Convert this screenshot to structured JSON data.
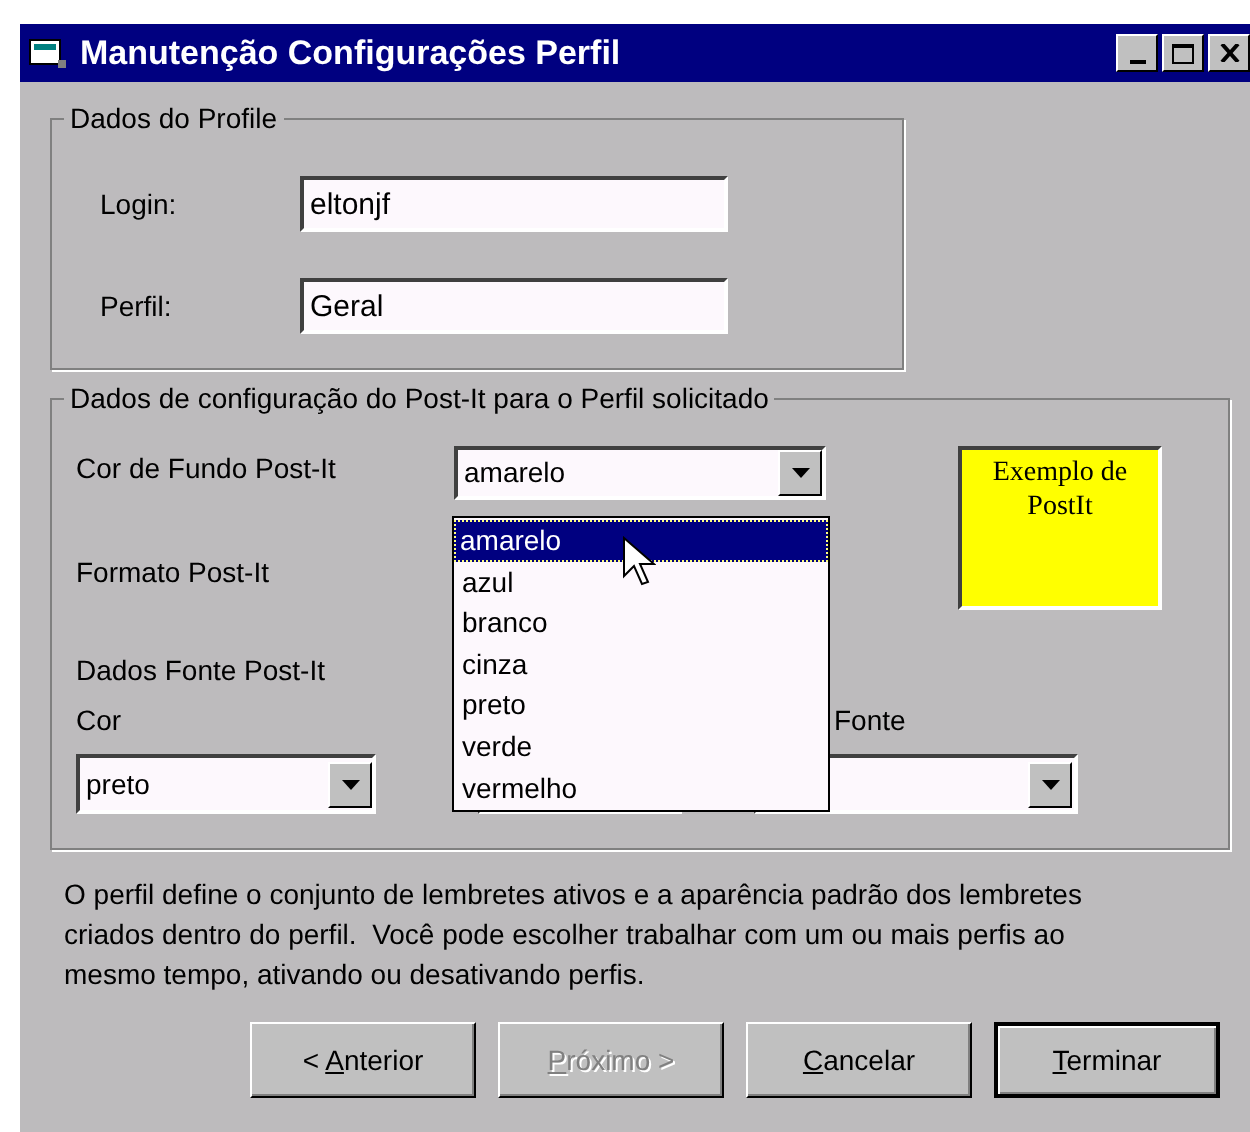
{
  "window": {
    "title": "Manutenção Configurações Perfil"
  },
  "profile_group": {
    "legend": "Dados do Profile",
    "fields": [
      {
        "label": "Login:",
        "value": "eltonjf"
      },
      {
        "label": "Perfil:",
        "value": "Geral"
      }
    ]
  },
  "postit_group": {
    "legend": "Dados de configuração do Post-It para o Perfil solicitado",
    "background_label": "Cor de Fundo Post-It",
    "background_value": "amarelo",
    "format_label": "Formato Post-It",
    "preview": {
      "text": "Exemplo de PostIt",
      "color": "#ffff00"
    },
    "font_label": "Dados Fonte Post-It",
    "font_color_label": "Cor",
    "font_color_value": "preto",
    "font_label_3": "Fonte",
    "dropdown": [
      {
        "text": "amarelo",
        "selected": true
      },
      {
        "text": "azul",
        "selected": false
      },
      {
        "text": "branco",
        "selected": false
      },
      {
        "text": "cinza",
        "selected": false
      },
      {
        "text": "preto",
        "selected": false
      },
      {
        "text": "verde",
        "selected": false
      },
      {
        "text": "vermelho",
        "selected": false
      }
    ]
  },
  "description": "O perfil define o conjunto de lembretes ativos e a aparência padrão dos lembretes criados dentro do perfil.  Você pode escolher trabalhar com um ou mais perfis ao mesmo tempo, ativando ou desativando perfis.",
  "buttons": [
    {
      "prefix": "< ",
      "key": "A",
      "rest": "nterior",
      "disabled": false,
      "default": false
    },
    {
      "key": "P",
      "rest": "róximo >",
      "disabled": true,
      "default": false
    },
    {
      "key": "C",
      "rest": "ancelar",
      "disabled": false,
      "default": false
    },
    {
      "key": "T",
      "rest": "erminar",
      "disabled": false,
      "default": true
    }
  ]
}
